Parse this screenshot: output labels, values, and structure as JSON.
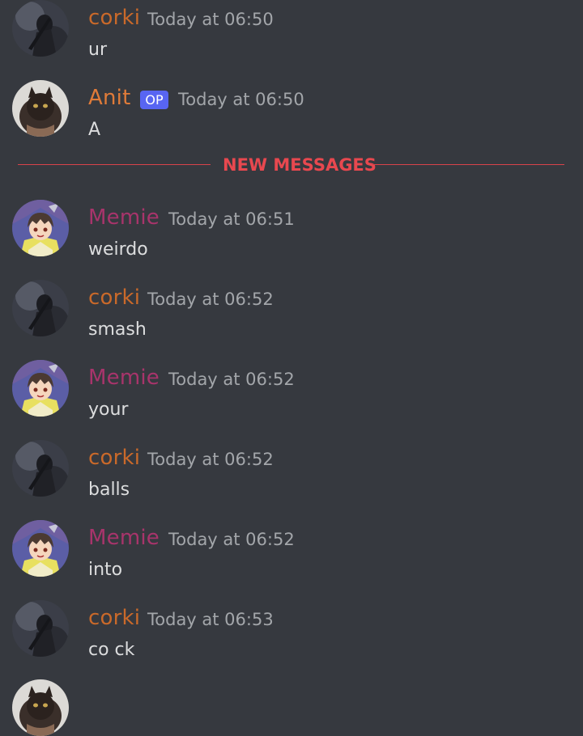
{
  "colors": {
    "background": "#36393f",
    "corki": "#c9692a",
    "anit": "#e07b39",
    "memie": "#a8346b",
    "op_badge": "#5865f2",
    "new_messages": "#e8484f"
  },
  "messages": [
    {
      "author": "corki",
      "time": "Today at 06:50",
      "text": "ur",
      "avatar": "dark-figure-avatar"
    },
    {
      "author": "Anit",
      "op_badge": "OP",
      "time": "Today at 06:50",
      "text": "A",
      "avatar": "cat-avatar"
    },
    {
      "author": "Memie",
      "time": "Today at 06:51",
      "text": "weirdo",
      "avatar": "anime-avatar"
    },
    {
      "author": "corki",
      "time": "Today at 06:52",
      "text": "smash",
      "avatar": "dark-figure-avatar"
    },
    {
      "author": "Memie",
      "time": "Today at 06:52",
      "text": "your",
      "avatar": "anime-avatar"
    },
    {
      "author": "corki",
      "time": "Today at 06:52",
      "text": "balls",
      "avatar": "dark-figure-avatar"
    },
    {
      "author": "Memie",
      "time": "Today at 06:52",
      "text": "into",
      "avatar": "anime-avatar"
    },
    {
      "author": "corki",
      "time": "Today at 06:53",
      "text": "co ck",
      "avatar": "dark-figure-avatar"
    }
  ],
  "divider": {
    "label": "NEW MESSAGES"
  }
}
